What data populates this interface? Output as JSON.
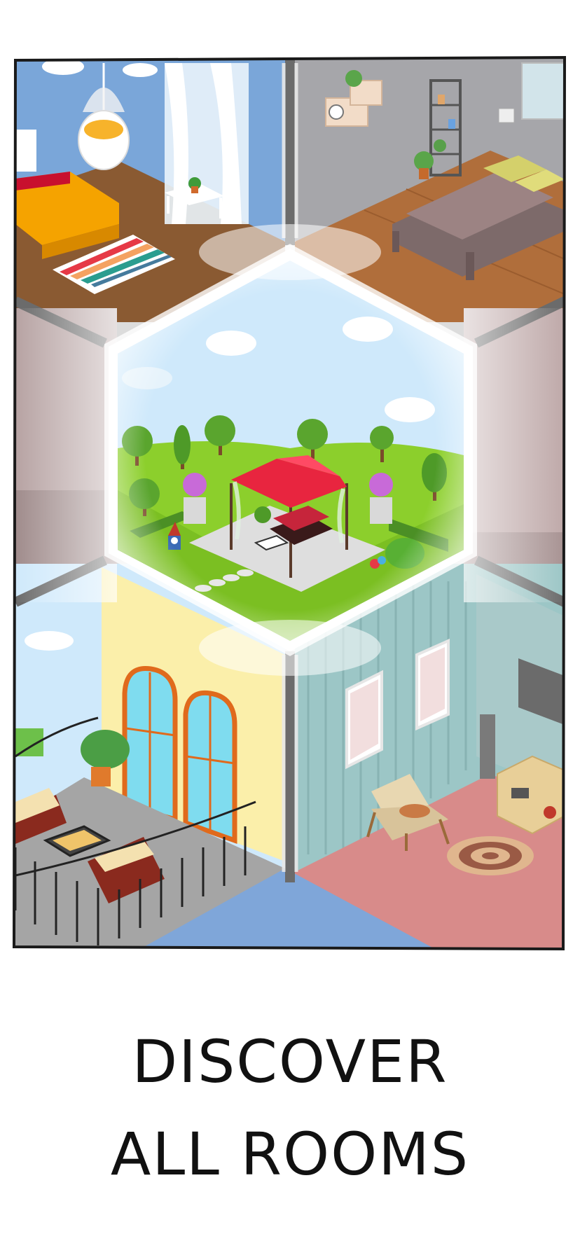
{
  "caption": {
    "line1": "DISCOVER",
    "line2": "ALL ROOMS"
  },
  "colors": {
    "frame_stroke": "#1a1a1a",
    "background": "#ffffff",
    "sky": "#cfe9fb",
    "grass": "#8ccf2c",
    "canopy": "#e8253f",
    "bedroom_wall": "#7aa6d9",
    "bedroom_floor": "#8a5a32",
    "bed_orange": "#f5a300",
    "grey_wall": "#a6a6aa",
    "wood_floor": "#b06e3b",
    "balcony_wall": "#fbefaa",
    "window_orange": "#e06a1c",
    "teal_wall": "#9cc6c6",
    "pink_floor": "#d88b8a"
  },
  "rooms": [
    {
      "name": "bedroom",
      "icons": [
        "hanging-crib-icon",
        "bed-icon",
        "striped-rug-icon",
        "side-table-icon",
        "window-curtain-icon"
      ]
    },
    {
      "name": "guest-bedroom",
      "icons": [
        "shelf-icon",
        "wall-clock-icon",
        "bookcase-icon",
        "double-bed-icon",
        "potted-plant-icon"
      ]
    },
    {
      "name": "garden",
      "icons": [
        "canopy-gazebo-icon",
        "tree-icon",
        "flower-urn-icon",
        "garden-gnome-icon",
        "hedge-icon",
        "cloud-icon"
      ]
    },
    {
      "name": "balcony",
      "icons": [
        "arched-window-icon",
        "wrought-iron-railing-icon",
        "armchair-icon",
        "coffee-table-icon",
        "monstera-plant-icon"
      ]
    },
    {
      "name": "living-room",
      "icons": [
        "window-icon",
        "speaker-icon",
        "armchair-icon",
        "round-rug-icon",
        "tv-icon",
        "cabinet-icon"
      ]
    }
  ]
}
